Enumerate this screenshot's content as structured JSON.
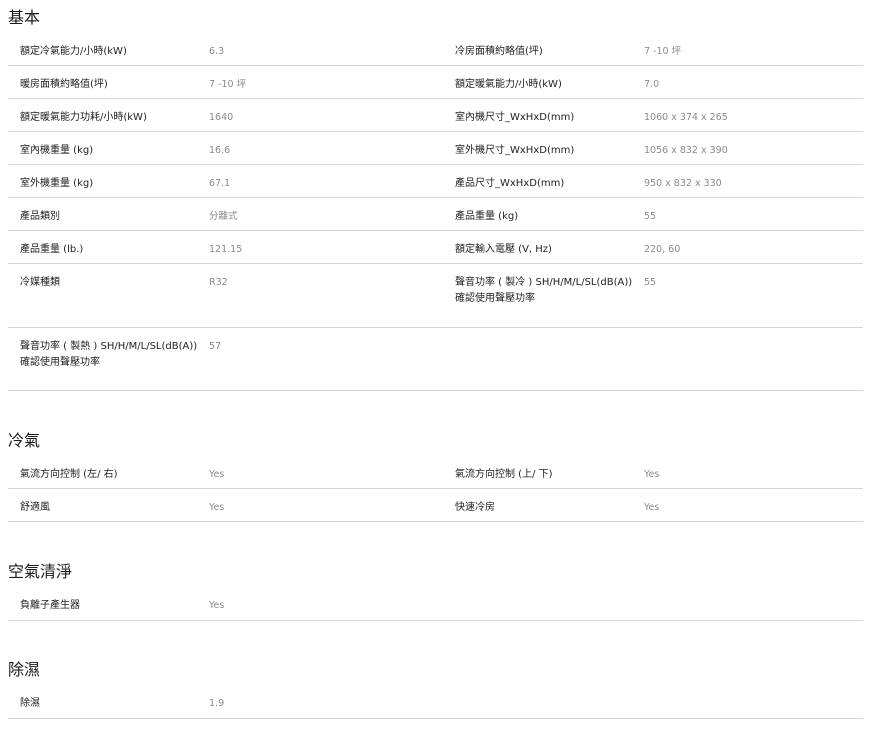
{
  "sections": [
    {
      "title": "基本",
      "rows": [
        {
          "l1": "額定冷氣能力/小時(kW)",
          "v1": "6.3",
          "l2": "冷房面積約略值(坪)",
          "v2": "7 -10 坪"
        },
        {
          "l1": "暖房面積約略值(坪)",
          "v1": "7 -10 坪",
          "l2": "額定暖氣能力/小時(kW)",
          "v2": "7.0"
        },
        {
          "l1": "額定暖氣能力功耗/小時(kW)",
          "v1": "1640",
          "l2": "室內機尺寸_WxHxD(mm)",
          "v2": "1060 x 374 x 265"
        },
        {
          "l1": "室內機重量 (kg)",
          "v1": "16.6",
          "l2": "室外機尺寸_WxHxD(mm)",
          "v2": "1056 x 832 x 390"
        },
        {
          "l1": "室外機重量 (kg)",
          "v1": "67.1",
          "l2": "產品尺寸_WxHxD(mm)",
          "v2": "950 x 832 x 330"
        },
        {
          "l1": "產品類別",
          "v1": "分離式",
          "l2": "產品重量 (kg)",
          "v2": "55"
        },
        {
          "l1": "產品重量 (lb.)",
          "v1": "121.15",
          "l2": "額定輸入電壓 (V, Hz)",
          "v2": "220, 60"
        },
        {
          "l1": "冷媒種類",
          "v1": "R32",
          "l2": "聲音功率 ( 製冷 ) SH/H/M/L/SL(dB(A))確認使用聲壓功率",
          "v2": "55"
        },
        {
          "l1": "聲音功率 ( 製熱 ) SH/H/M/L/SL(dB(A))確認使用聲壓功率",
          "v1": "57",
          "l2": "",
          "v2": ""
        }
      ]
    },
    {
      "title": "冷氣",
      "rows": [
        {
          "l1": "氣流方向控制 (左/ 右)",
          "v1": "Yes",
          "l2": "氣流方向控制 (上/ 下)",
          "v2": "Yes"
        },
        {
          "l1": "舒適風",
          "v1": "Yes",
          "l2": "快速冷房",
          "v2": "Yes"
        }
      ]
    },
    {
      "title": "空氣清淨",
      "rows": [
        {
          "l1": "負離子產生器",
          "v1": "Yes",
          "l2": "",
          "v2": ""
        }
      ]
    },
    {
      "title": "除濕",
      "rows": [
        {
          "l1": "除濕",
          "v1": "1.9",
          "l2": "",
          "v2": ""
        }
      ]
    }
  ]
}
